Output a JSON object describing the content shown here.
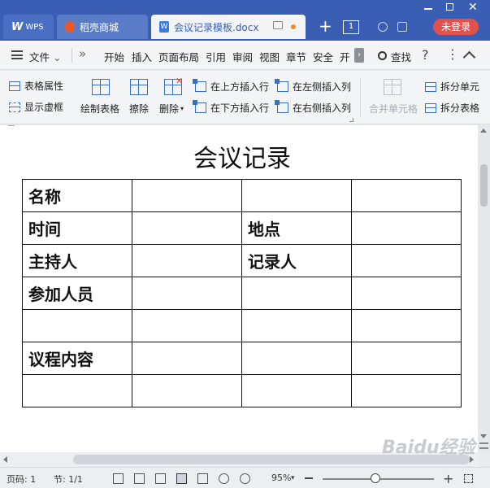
{
  "titlebar": {
    "tabs": [
      {
        "logo": "W",
        "label": "WPS"
      },
      {
        "label": "稻壳商城"
      },
      {
        "label": "会议记录模板.docx"
      }
    ],
    "tab_count": "1",
    "login_label": "未登录"
  },
  "menubar": {
    "file_label": "文件",
    "items": [
      "开始",
      "插入",
      "页面布局",
      "引用",
      "审阅",
      "视图",
      "章节",
      "安全",
      "开"
    ],
    "search_label": "查找",
    "help_label": "?",
    "more_label": "⋮"
  },
  "ribbon": {
    "table_props": "表格属性",
    "show_gridlines": "显示虚框",
    "draw_table": "绘制表格",
    "erase": "擦除",
    "delete": "删除",
    "insert_above": "在上方插入行",
    "insert_below": "在下方插入行",
    "insert_left": "在左侧插入列",
    "insert_right": "在右侧插入列",
    "merge_cells": "合并单元格",
    "split_cells": "拆分单元",
    "split_table": "拆分表格"
  },
  "document": {
    "title": "会议记录",
    "table": [
      [
        "名称",
        "",
        "",
        ""
      ],
      [
        "时间",
        "",
        "地点",
        ""
      ],
      [
        "主持人",
        "",
        "记录人",
        ""
      ],
      [
        "参加人员",
        "",
        "",
        ""
      ],
      [
        "",
        "",
        "",
        ""
      ],
      [
        "议程内容",
        "",
        "",
        ""
      ],
      [
        "",
        "",
        "",
        ""
      ]
    ]
  },
  "statusbar": {
    "page_label": "页码: 1",
    "section_label": "节: 1/1",
    "zoom_label": "95%",
    "zoom_level_percent": 95
  },
  "watermark": "Baidu经验",
  "colors": {
    "titlebar_bg": "#3a5eb4",
    "login_btn": "#e2524c",
    "accent_blue": "#3a6fc6"
  }
}
